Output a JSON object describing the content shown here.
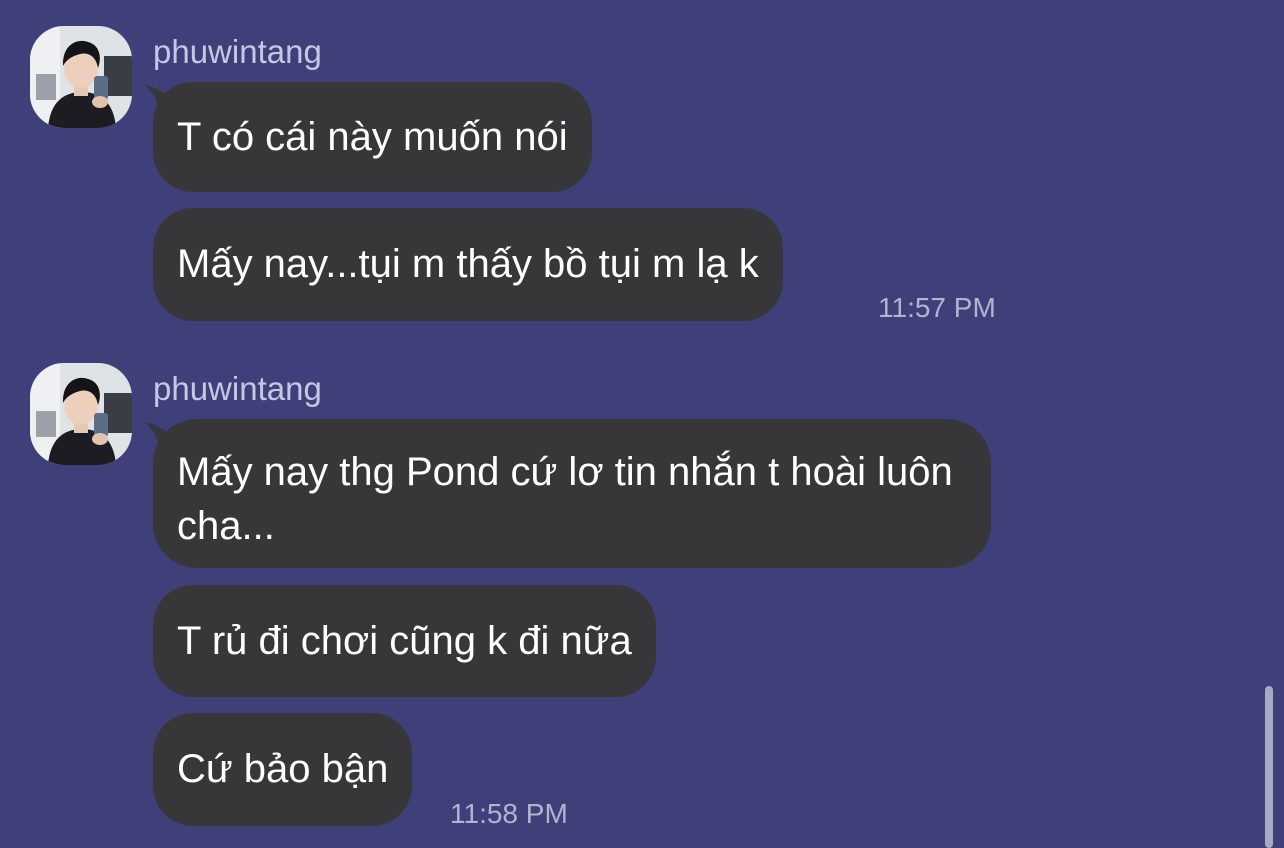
{
  "theme": {
    "background": "#3f4079",
    "bubble": "#373739",
    "bubble_text": "#ffffff",
    "sender_text": "#c7c6e4",
    "time_text": "#b3b3cf"
  },
  "groups": [
    {
      "sender": "phuwintang",
      "avatar_icon": "user-avatar-photo",
      "messages": [
        {
          "text": "T có cái này muốn nói"
        },
        {
          "text": "Mấy nay...tụi m thấy bồ tụi m lạ k"
        }
      ],
      "time": "11:57 PM"
    },
    {
      "sender": "phuwintang",
      "avatar_icon": "user-avatar-photo",
      "messages": [
        {
          "text": "Mấy nay thg Pond cứ lơ tin nhắn t hoài luôn cha..."
        },
        {
          "text": "T rủ đi chơi cũng k đi nữa"
        },
        {
          "text": "Cứ bảo bận"
        }
      ],
      "time": "11:58 PM"
    }
  ]
}
